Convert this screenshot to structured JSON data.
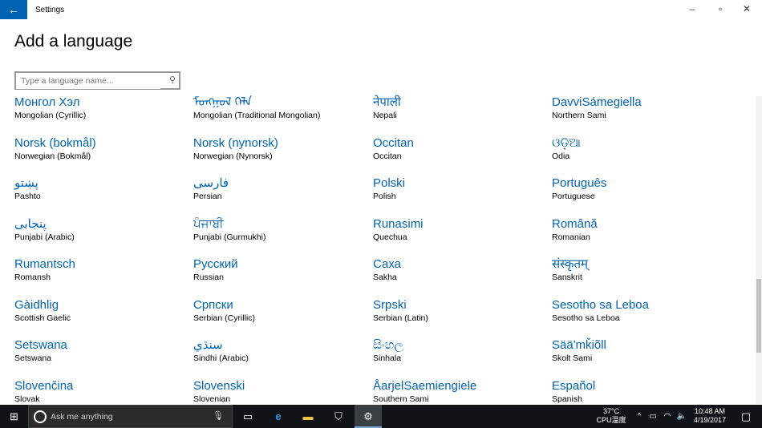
{
  "window": {
    "title": "Settings",
    "back_icon": "arrow-left-icon",
    "minimize": "–",
    "maximize": "▫",
    "close": "✕"
  },
  "page": {
    "title": "Add a language",
    "search_placeholder": "Type a language name...",
    "search_icon": "magnifier-icon"
  },
  "languages": [
    {
      "native": "Монгол Хэл",
      "english": "Mongolian (Cyrillic)"
    },
    {
      "native": "ᠮᠣᠩᠭᠣᠯ ᠬᠡᠯᠡ",
      "english": "Mongolian (Traditional Mongolian)"
    },
    {
      "native": "नेपाली",
      "english": "Nepali"
    },
    {
      "native": "DavviSámegiella",
      "english": "Northern Sami"
    },
    {
      "native": "Norsk (bokmål)",
      "english": "Norwegian (Bokmål)"
    },
    {
      "native": "Norsk (nynorsk)",
      "english": "Norwegian (Nynorsk)"
    },
    {
      "native": "Occitan",
      "english": "Occitan"
    },
    {
      "native": "ଓଡ଼ିଆ",
      "english": "Odia"
    },
    {
      "native": "پښتو",
      "english": "Pashto"
    },
    {
      "native": "فارسی",
      "english": "Persian"
    },
    {
      "native": "Polski",
      "english": "Polish"
    },
    {
      "native": "Português",
      "english": "Portuguese"
    },
    {
      "native": "پنجابی",
      "english": "Punjabi (Arabic)"
    },
    {
      "native": "ਪੰਜਾਬੀ",
      "english": "Punjabi (Gurmukhi)"
    },
    {
      "native": "Runasimi",
      "english": "Quechua"
    },
    {
      "native": "Română",
      "english": "Romanian"
    },
    {
      "native": "Rumantsch",
      "english": "Romansh"
    },
    {
      "native": "Русский",
      "english": "Russian"
    },
    {
      "native": "Саха",
      "english": "Sakha"
    },
    {
      "native": "संस्कृतम्",
      "english": "Sanskrit"
    },
    {
      "native": "Gàidhlig",
      "english": "Scottish Gaelic"
    },
    {
      "native": "Српски",
      "english": "Serbian (Cyrillic)"
    },
    {
      "native": "Srpski",
      "english": "Serbian (Latin)"
    },
    {
      "native": "Sesotho sa Leboa",
      "english": "Sesotho sa Leboa"
    },
    {
      "native": "Setswana",
      "english": "Setswana"
    },
    {
      "native": "سنڌي",
      "english": "Sindhi (Arabic)"
    },
    {
      "native": "සිංහල",
      "english": "Sinhala"
    },
    {
      "native": "Sääʹmǩiõll",
      "english": "Skolt Sami"
    },
    {
      "native": "Slovenčina",
      "english": "Slovak"
    },
    {
      "native": "Slovenski",
      "english": "Slovenian"
    },
    {
      "native": "ÅarjelSaemiengiele",
      "english": "Southern Sami"
    },
    {
      "native": "Español",
      "english": "Spanish"
    }
  ],
  "taskbar": {
    "search_placeholder": "Ask me anything",
    "temp": "37°C",
    "temp_label": "CPU温度",
    "time": "10:48 AM",
    "date": "4/19/2017"
  },
  "colors": {
    "accent": "#0063b1",
    "taskbar": "#101418"
  }
}
